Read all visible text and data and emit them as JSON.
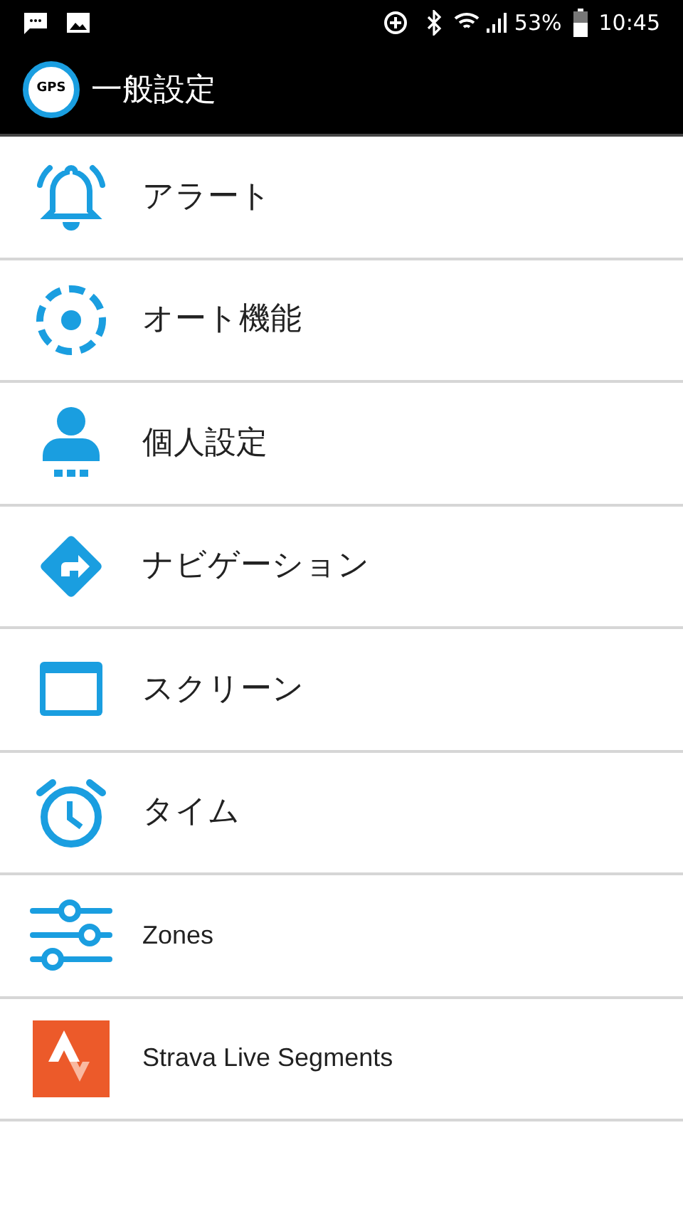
{
  "status_bar": {
    "battery": "53%",
    "time": "10:45"
  },
  "app_bar": {
    "logo_text": "GPS",
    "title": "一般設定"
  },
  "items": [
    {
      "kind": "bell",
      "label": "アラート"
    },
    {
      "kind": "auto",
      "label": "オート機能"
    },
    {
      "kind": "person",
      "label": "個人設定"
    },
    {
      "kind": "navigation",
      "label": "ナビゲーション"
    },
    {
      "kind": "screen",
      "label": "スクリーン"
    },
    {
      "kind": "clock",
      "label": "タイム"
    },
    {
      "kind": "sliders",
      "label": "Zones"
    },
    {
      "kind": "strava",
      "label": "Strava Live Segments"
    }
  ]
}
